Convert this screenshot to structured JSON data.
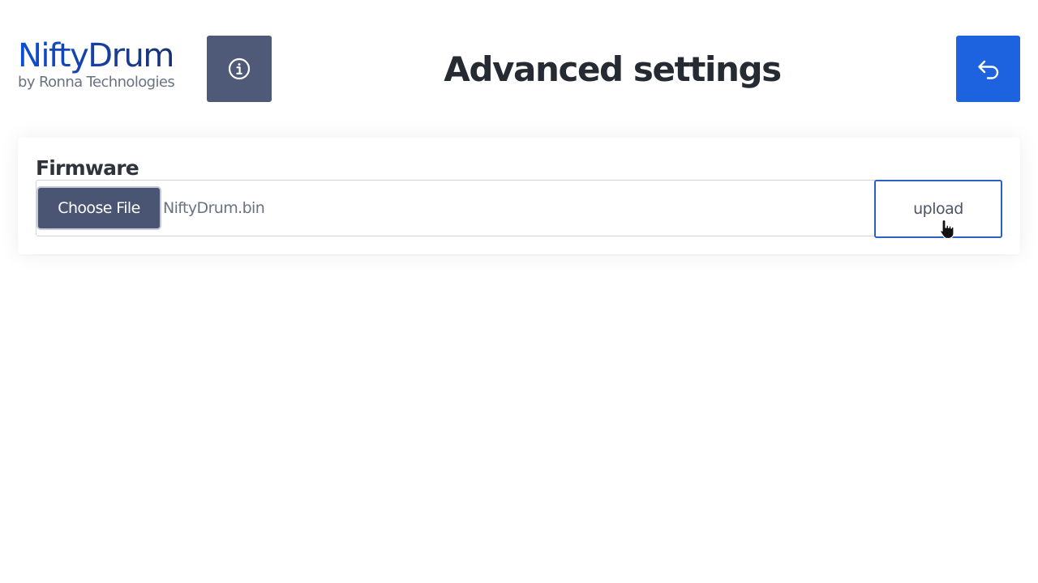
{
  "brand": {
    "name": "NiftyDrum",
    "subtitle": "by Ronna Technologies"
  },
  "header": {
    "title": "Advanced settings",
    "info_icon": "info-circle-icon",
    "back_icon": "undo-arrow-icon"
  },
  "firmware": {
    "title": "Firmware",
    "choose_label": "Choose File",
    "file_name": "NiftyDrum.bin",
    "upload_label": "upload"
  },
  "colors": {
    "brand_blue": "#1d4ed8",
    "info_button": "#4e5a78",
    "back_button": "#1d63e0",
    "choose_button": "#4a5573",
    "upload_border": "#2b5fc0",
    "title_text": "#262b33"
  },
  "cursor": {
    "icon": "hand-pointer-icon"
  }
}
